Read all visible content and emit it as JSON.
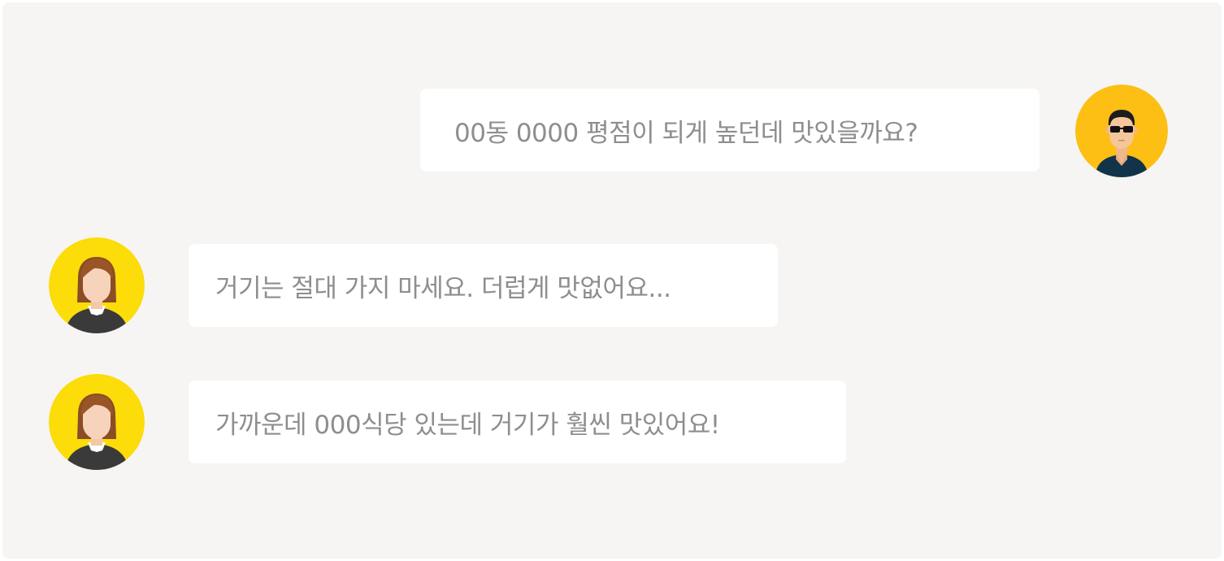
{
  "conversation": {
    "messages": [
      {
        "sender": "man",
        "side": "right",
        "text": "00동 0000 평점이 되게 높던데 맛있을까요?"
      },
      {
        "sender": "woman",
        "side": "left",
        "text": "거기는 절대 가지 마세요. 더럽게 맛없어요..."
      },
      {
        "sender": "woman",
        "side": "left",
        "text": "가까운데 000식당 있는데 거기가 훨씬 맛있어요!"
      }
    ]
  },
  "colors": {
    "background": "#f6f5f3",
    "bubble": "#ffffff",
    "text": "#8e8e8e",
    "man_avatar_bg": "#fdbf14",
    "woman_avatar_bg": "#fcdc09"
  },
  "icons": {
    "man": "man-with-sunglasses-avatar-icon",
    "woman": "woman-avatar-icon"
  }
}
